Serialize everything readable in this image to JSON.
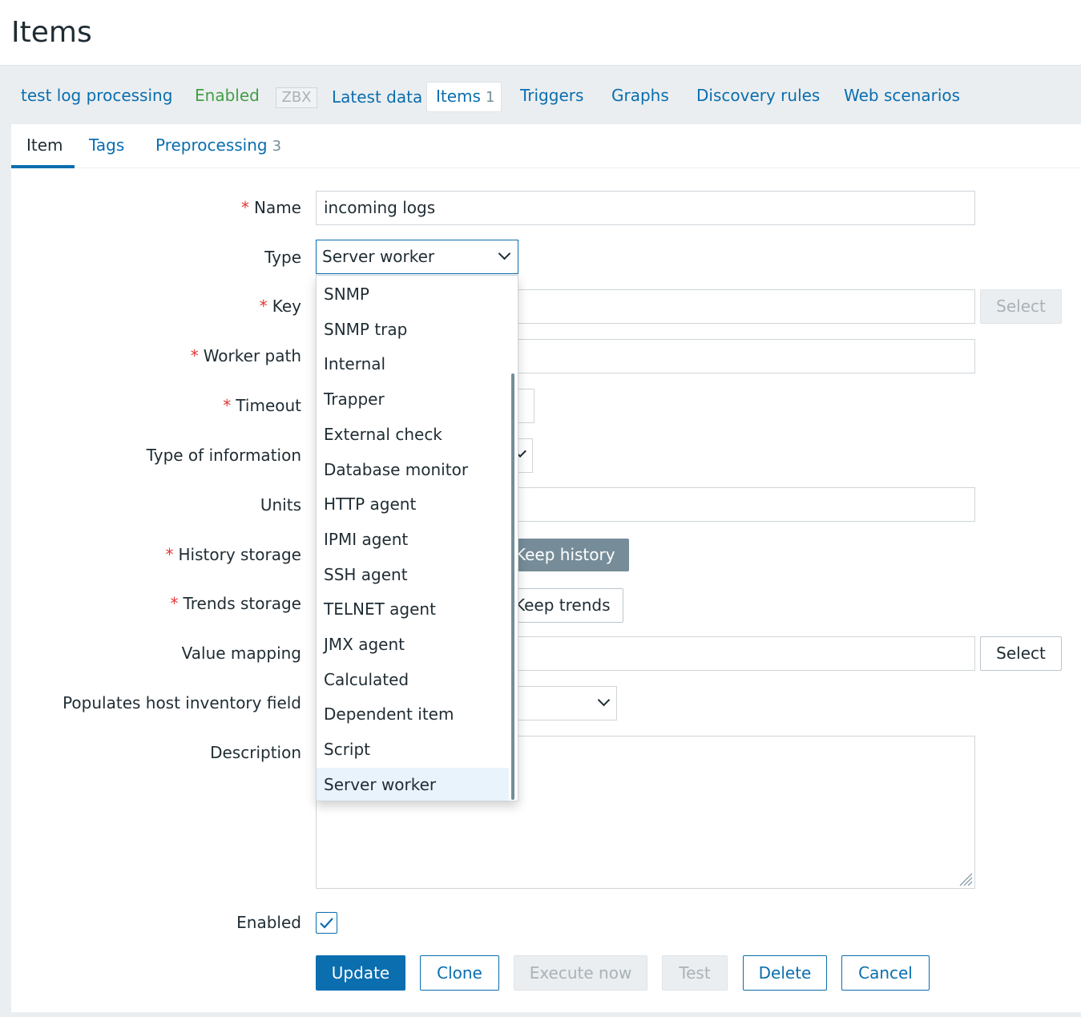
{
  "page": {
    "title": "Items"
  },
  "host_nav": {
    "host_name": "test log processing",
    "status": "Enabled",
    "zbx_badge": "ZBX",
    "latest_data": "Latest data",
    "items_label": "Items",
    "items_count": "1",
    "triggers": "Triggers",
    "graphs": "Graphs",
    "discovery_rules": "Discovery rules",
    "web_scenarios": "Web scenarios"
  },
  "tabs": {
    "item": "Item",
    "tags": "Tags",
    "preprocessing": "Preprocessing",
    "preprocessing_count": "3"
  },
  "form": {
    "name_label": "Name",
    "name_value": "incoming logs",
    "type_label": "Type",
    "type_value": "Server worker",
    "key_label": "Key",
    "key_select": "Select",
    "worker_path_label": "Worker path",
    "timeout_label": "Timeout",
    "type_of_information_label": "Type of information",
    "units_label": "Units",
    "history_storage_label": "History storage",
    "keep_history": "Keep history",
    "trends_storage_label": "Trends storage",
    "keep_trends": "Keep trends",
    "value_mapping_label": "Value mapping",
    "value_mapping_select": "Select",
    "inventory_label": "Populates host inventory field",
    "description_label": "Description",
    "enabled_label": "Enabled",
    "enabled_checked": true
  },
  "type_dropdown": {
    "options": [
      "SNMP",
      "SNMP trap",
      "Internal",
      "Trapper",
      "External check",
      "Database monitor",
      "HTTP agent",
      "IPMI agent",
      "SSH agent",
      "TELNET agent",
      "JMX agent",
      "Calculated",
      "Dependent item",
      "Script",
      "Server worker"
    ],
    "selected": "Server worker"
  },
  "buttons": {
    "update": "Update",
    "clone": "Clone",
    "execute_now": "Execute now",
    "test": "Test",
    "delete": "Delete",
    "cancel": "Cancel"
  },
  "colors": {
    "primary": "#0a6eaf",
    "status_enabled": "#429e47",
    "required": "#e33734"
  }
}
